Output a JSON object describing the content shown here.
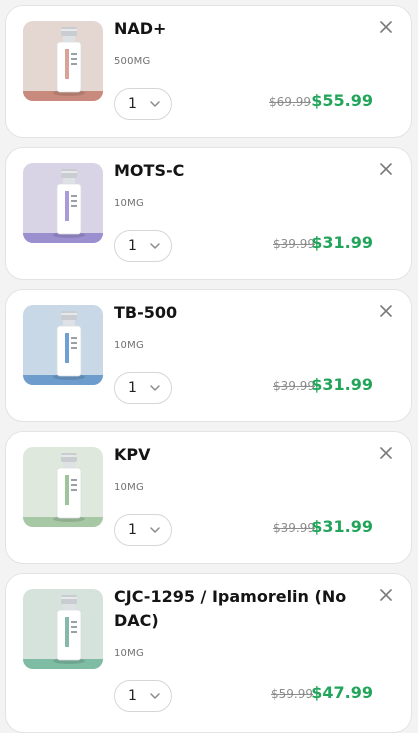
{
  "cart": {
    "items": [
      {
        "name": "NAD+",
        "variant": "500MG",
        "quantity": "1",
        "original_price": "$69.99",
        "sale_price": "$55.99",
        "thumb_bg": "#e4d6d1",
        "thumb_band": "#c88a7c",
        "vial_label": "#ffffff",
        "vial_stripe": "#d8a49a"
      },
      {
        "name": "MOTS-C",
        "variant": "10MG",
        "quantity": "1",
        "original_price": "$39.99",
        "sale_price": "$31.99",
        "thumb_bg": "#d8d4e6",
        "thumb_band": "#9b8fd0",
        "vial_label": "#ffffff",
        "vial_stripe": "#a89bd8"
      },
      {
        "name": "TB-500",
        "variant": "10MG",
        "quantity": "1",
        "original_price": "$39.99",
        "sale_price": "$31.99",
        "thumb_bg": "#c9d8e6",
        "thumb_band": "#6e9ccc",
        "vial_label": "#ffffff",
        "vial_stripe": "#6f9fd3"
      },
      {
        "name": "KPV",
        "variant": "10MG",
        "quantity": "1",
        "original_price": "$39.99",
        "sale_price": "$31.99",
        "thumb_bg": "#dfe8dd",
        "thumb_band": "#a6c8a4",
        "vial_label": "#ffffff",
        "vial_stripe": "#9fc49d"
      },
      {
        "name": "CJC-1295 / Ipamorelin (No DAC)",
        "variant": "10MG",
        "quantity": "1",
        "original_price": "$59.99",
        "sale_price": "$47.99",
        "thumb_bg": "#d6e2dc",
        "thumb_band": "#7fbca4",
        "vial_label": "#ffffff",
        "vial_stripe": "#86b9a8"
      }
    ],
    "icons": {
      "remove": "close-icon",
      "quantity_dropdown": "chevron-down-icon"
    },
    "colors": {
      "sale_price": "#22a55a",
      "original_price": "#8c8c8c"
    }
  }
}
